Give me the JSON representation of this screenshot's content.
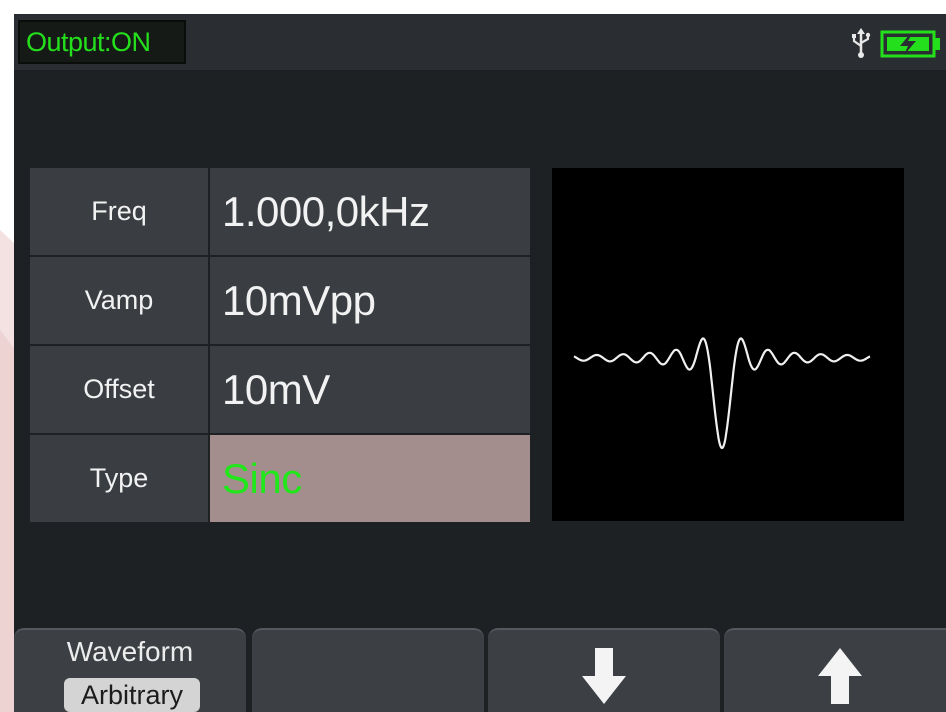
{
  "status": {
    "output_label": "Output:ON",
    "usb_icon": "usb-icon",
    "battery_icon": "battery-charging-icon"
  },
  "params": [
    {
      "label": "Freq",
      "value": "1.000,0kHz"
    },
    {
      "label": "Vamp",
      "value": "10mVpp"
    },
    {
      "label": "Offset",
      "value": "10mV"
    },
    {
      "label": "Type",
      "value": "Sinc",
      "selected": true
    }
  ],
  "preview": {
    "waveform": "Sinc",
    "icon": "waveform-preview"
  },
  "softkeys": [
    {
      "title": "Waveform",
      "value": "Arbitrary"
    },
    {
      "title": "",
      "value": ""
    },
    {
      "icon": "arrow-down-icon"
    },
    {
      "icon": "arrow-up-icon"
    }
  ],
  "colors": {
    "accent_green": "#24e01c",
    "selected_bg": "#a38d8d",
    "panel_bg": "#3a3e43",
    "screen_bg": "#1e2124"
  }
}
